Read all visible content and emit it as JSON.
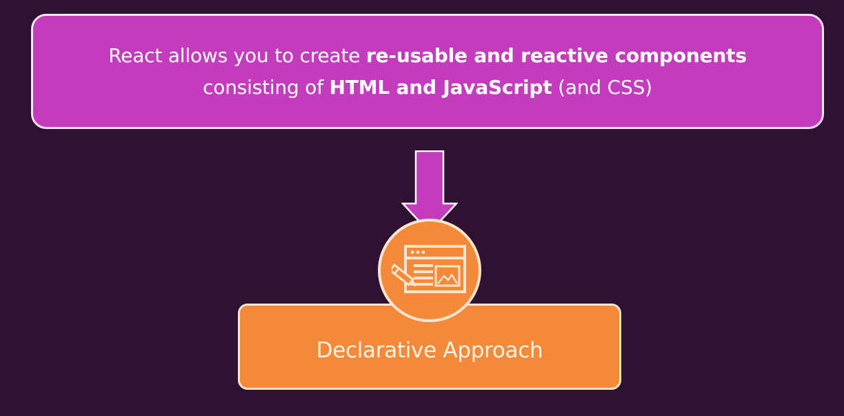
{
  "headline": {
    "line1_prefix": "React allows you to create ",
    "line1_bold": "re-usable and reactive components",
    "line2_prefix": "consisting of ",
    "line2_bold": "HTML and JavaScript",
    "line2_suffix": " (and CSS)"
  },
  "result": {
    "label": "Declarative Approach",
    "icon": "web-page-edit-icon"
  },
  "colors": {
    "background": "#2f1131",
    "headline_fill": "#c23cbd",
    "result_fill": "#f48a39",
    "arrow": "#c23cbd",
    "border_light": "#fbe6d2"
  }
}
